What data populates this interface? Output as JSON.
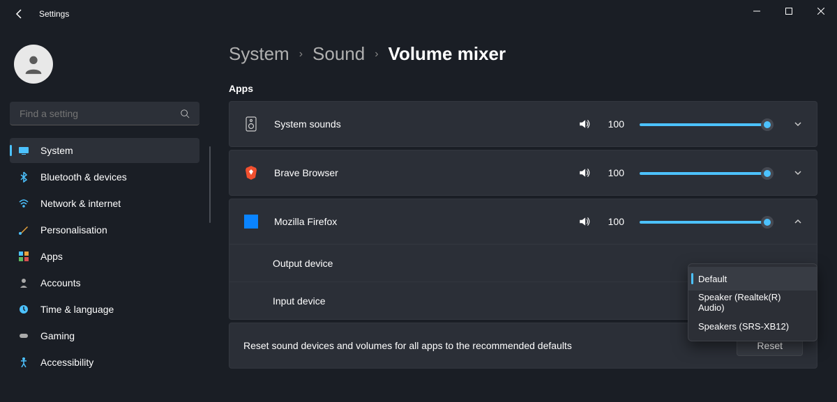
{
  "window": {
    "title": "Settings"
  },
  "search": {
    "placeholder": "Find a setting"
  },
  "nav": {
    "items": [
      {
        "label": "System"
      },
      {
        "label": "Bluetooth & devices"
      },
      {
        "label": "Network & internet"
      },
      {
        "label": "Personalisation"
      },
      {
        "label": "Apps"
      },
      {
        "label": "Accounts"
      },
      {
        "label": "Time & language"
      },
      {
        "label": "Gaming"
      },
      {
        "label": "Accessibility"
      }
    ]
  },
  "breadcrumb": {
    "c1": "System",
    "c2": "Sound",
    "current": "Volume mixer"
  },
  "section": "Apps",
  "apps": [
    {
      "name": "System sounds",
      "volume": "100"
    },
    {
      "name": "Brave Browser",
      "volume": "100"
    },
    {
      "name": "Mozilla Firefox",
      "volume": "100"
    }
  ],
  "sub": {
    "output": "Output device",
    "input": "Input device"
  },
  "reset": {
    "text": "Reset sound devices and volumes for all apps to the recommended defaults",
    "button": "Reset"
  },
  "dropdown": {
    "items": [
      {
        "label": "Default"
      },
      {
        "label": "Speaker (Realtek(R) Audio)"
      },
      {
        "label": "Speakers (SRS-XB12)"
      }
    ]
  }
}
